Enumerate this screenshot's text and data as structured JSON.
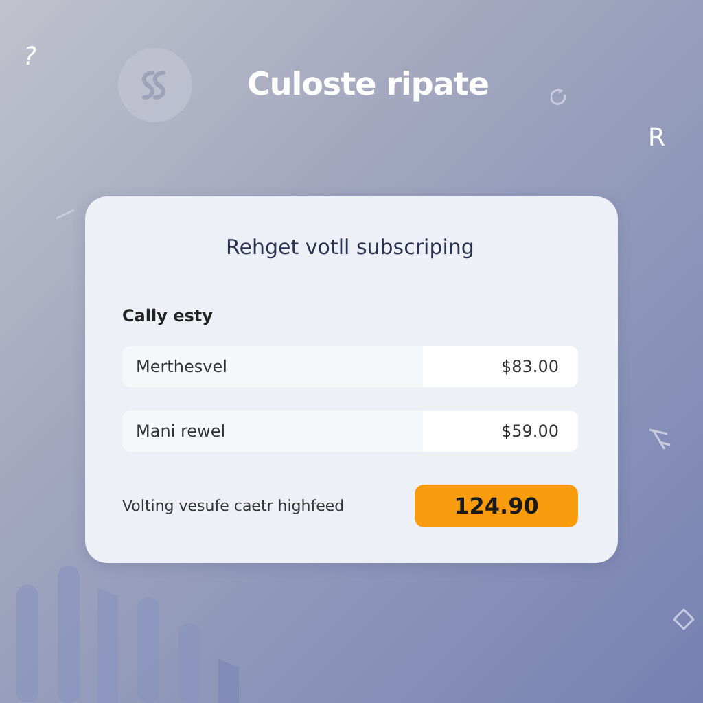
{
  "header": {
    "title": "Culoste ripate"
  },
  "decor": [
    {
      "text": "?",
      "kind": "glyph"
    },
    {
      "text": "R",
      "kind": "glyph"
    }
  ],
  "card": {
    "heading": "Rehget votll subscriping",
    "section_label": "Cally esty",
    "rows": [
      {
        "label": "Merthesvel",
        "price": "$83.00"
      },
      {
        "label": "Mani rewel",
        "price": "$59.00"
      }
    ],
    "footer_text": "Volting vesufe caetr highfeed",
    "total_button": "124.90"
  }
}
